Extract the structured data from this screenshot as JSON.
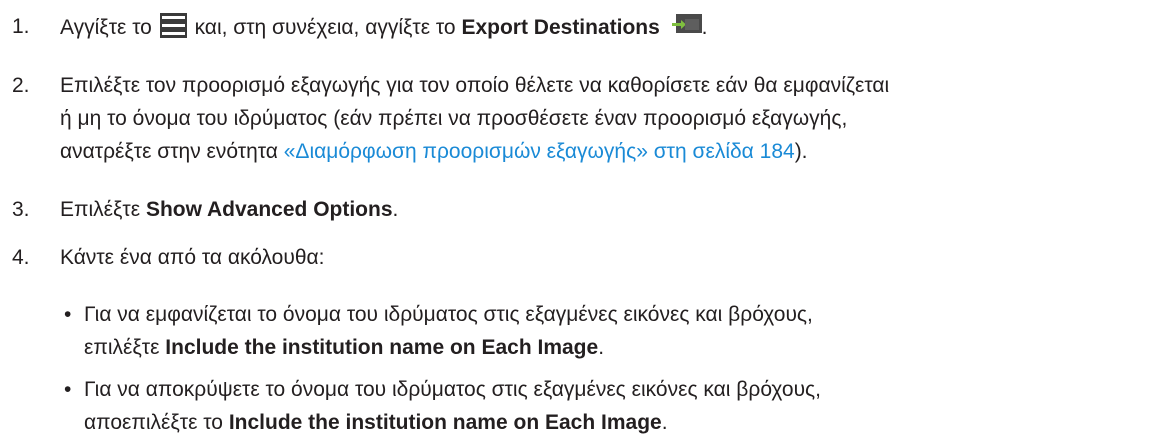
{
  "steps": [
    {
      "number": "1.",
      "text_a": "Αγγίξτε το",
      "text_b": "και, στη συνέχεια, αγγίξτε το",
      "bold": "Export Destinations",
      "end": "."
    },
    {
      "number": "2.",
      "line1": "Επιλέξτε τον προορισμό εξαγωγής για τον οποίο θέλετε να καθορίσετε εάν θα εμφανίζεται",
      "line2": "ή μη το όνομα του ιδρύματος (εάν πρέπει να προσθέσετε έναν προορισμό εξαγωγής,",
      "line3_pre": "ανατρέξτε στην ενότητα",
      "link": "«Διαμόρφωση προορισμών εξαγωγής» στη σελίδα 184",
      "line3_post": ")."
    },
    {
      "number": "3.",
      "text": "Επιλέξτε",
      "bold": "Show Advanced Options",
      "end": "."
    },
    {
      "number": "4.",
      "text": "Κάντε ένα από τα ακόλουθα:"
    }
  ],
  "bullets": [
    {
      "symbol": "•",
      "line1": "Για να εμφανίζεται το όνομα του ιδρύματος στις εξαγμένες εικόνες και βρόχους,",
      "line2_pre": "επιλέξτε",
      "bold": "Include the institution name on Each Image",
      "end": "."
    },
    {
      "symbol": "•",
      "line1": "Για να αποκρύψετε το όνομα του ιδρύματος στις εξαγμένες εικόνες και βρόχους,",
      "line2_pre": "αποεπιλέξτε το",
      "bold": "Include the institution name on Each Image",
      "end": "."
    }
  ],
  "icons": {
    "menu": "menu-icon",
    "export": "export-destinations-icon"
  }
}
